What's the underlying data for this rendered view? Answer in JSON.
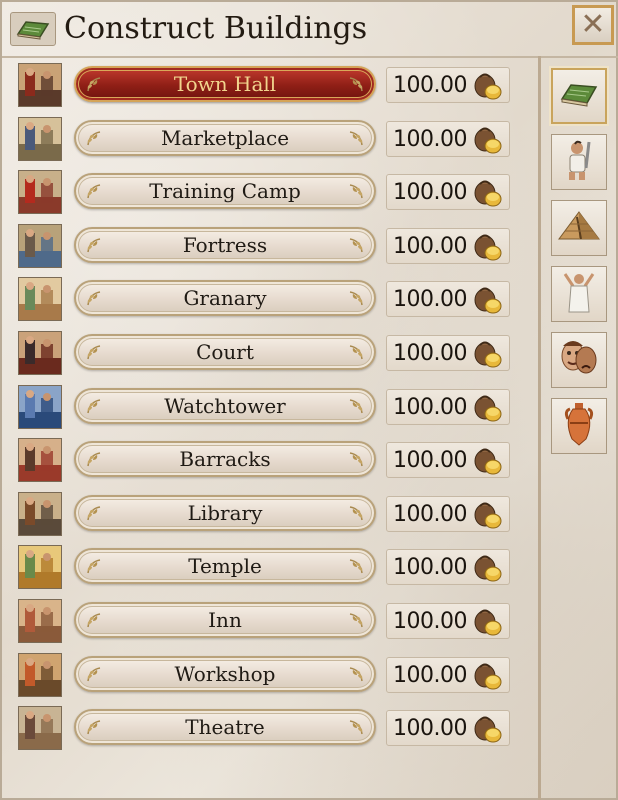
{
  "window": {
    "title": "Construct Buildings",
    "close_label": "✕",
    "header_icon": "building-book-icon"
  },
  "buildings": [
    {
      "name": "Town Hall",
      "cost": "100.00",
      "selected": true,
      "thumb": "town-hall-thumbnail"
    },
    {
      "name": "Marketplace",
      "cost": "100.00",
      "selected": false,
      "thumb": "marketplace-thumbnail"
    },
    {
      "name": "Training Camp",
      "cost": "100.00",
      "selected": false,
      "thumb": "training-camp-thumbnail"
    },
    {
      "name": "Fortress",
      "cost": "100.00",
      "selected": false,
      "thumb": "fortress-thumbnail"
    },
    {
      "name": "Granary",
      "cost": "100.00",
      "selected": false,
      "thumb": "granary-thumbnail"
    },
    {
      "name": "Court",
      "cost": "100.00",
      "selected": false,
      "thumb": "court-thumbnail"
    },
    {
      "name": "Watchtower",
      "cost": "100.00",
      "selected": false,
      "thumb": "watchtower-thumbnail"
    },
    {
      "name": "Barracks",
      "cost": "100.00",
      "selected": false,
      "thumb": "barracks-thumbnail"
    },
    {
      "name": "Library",
      "cost": "100.00",
      "selected": false,
      "thumb": "library-thumbnail"
    },
    {
      "name": "Temple",
      "cost": "100.00",
      "selected": false,
      "thumb": "temple-thumbnail"
    },
    {
      "name": "Inn",
      "cost": "100.00",
      "selected": false,
      "thumb": "inn-thumbnail"
    },
    {
      "name": "Workshop",
      "cost": "100.00",
      "selected": false,
      "thumb": "workshop-thumbnail"
    },
    {
      "name": "Theatre",
      "cost": "100.00",
      "selected": false,
      "thumb": "theatre-thumbnail"
    }
  ],
  "sidebar_tabs": [
    {
      "icon": "buildings-book-icon",
      "active": true
    },
    {
      "icon": "soldier-icon",
      "active": false
    },
    {
      "icon": "pyramid-icon",
      "active": false
    },
    {
      "icon": "priest-icon",
      "active": false
    },
    {
      "icon": "theatre-masks-icon",
      "active": false
    },
    {
      "icon": "amphora-icon",
      "active": false
    }
  ],
  "colors": {
    "selected_button": "#8f1f16",
    "selected_text": "#f1d48d",
    "accent_gold": "#c9a45c",
    "parchment": "#e9e2d8"
  }
}
